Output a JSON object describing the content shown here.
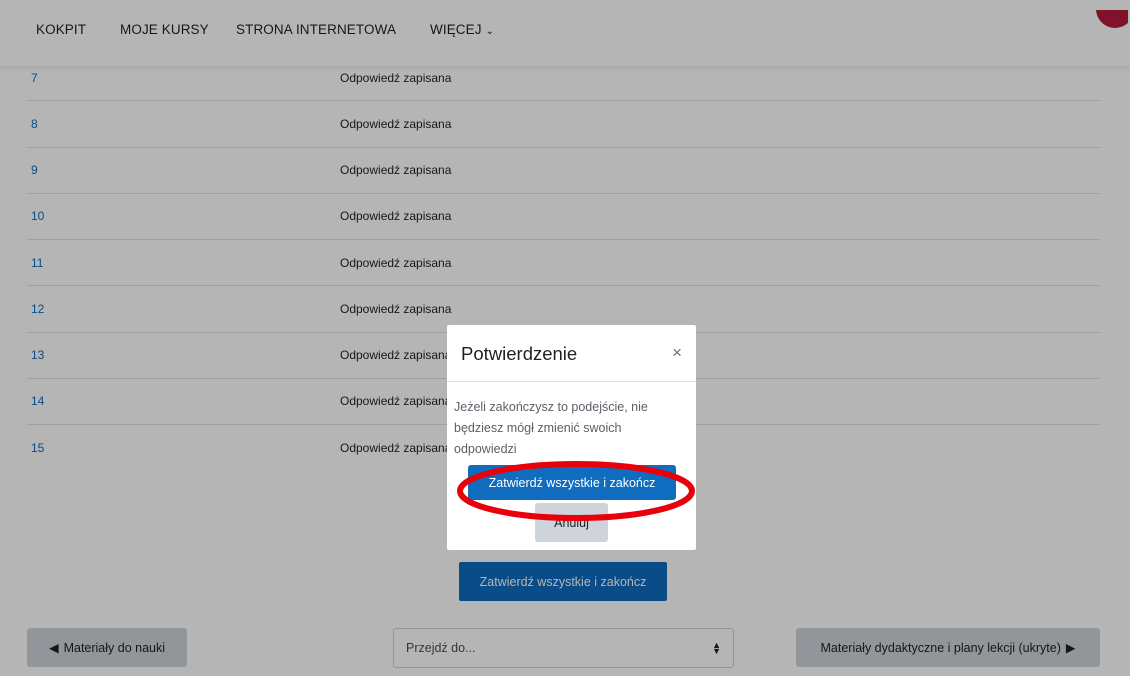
{
  "navbar": {
    "items": [
      {
        "label": "KOKPIT"
      },
      {
        "label": "MOJE KURSY"
      },
      {
        "label": "STRONA INTERNETOWA"
      },
      {
        "label": "WIĘCEJ"
      }
    ],
    "more_chevron": "⌄"
  },
  "summary": {
    "rows": [
      {
        "number": "7",
        "status": "Odpowiedź zapisana"
      },
      {
        "number": "8",
        "status": "Odpowiedź zapisana"
      },
      {
        "number": "9",
        "status": "Odpowiedź zapisana"
      },
      {
        "number": "10",
        "status": "Odpowiedź zapisana"
      },
      {
        "number": "11",
        "status": "Odpowiedź zapisana"
      },
      {
        "number": "12",
        "status": "Odpowiedź zapisana"
      },
      {
        "number": "13",
        "status": "Odpowiedź zapisana"
      },
      {
        "number": "14",
        "status": "Odpowiedź zapisana"
      },
      {
        "number": "15",
        "status": "Odpowiedź zapisana"
      }
    ],
    "submit_label": "Zatwierdź wszystkie i zakończ"
  },
  "navigation": {
    "prev_label": "Materiały do nauki",
    "prev_arrow": "◀",
    "jump_placeholder": "Przejdź do...",
    "next_label": "Materiały dydaktyczne i plany lekcji (ukryte)",
    "next_arrow": "▶"
  },
  "modal": {
    "title": "Potwierdzenie",
    "close_symbol": "×",
    "body": "Jeżeli zakończysz to podejście, nie będziesz mógł zmienić swoich odpowiedzi",
    "confirm_label": "Zatwierdź wszystkie i zakończ",
    "cancel_label": "Anuluj"
  },
  "colors": {
    "primary": "#0f6cbf",
    "secondary": "#ced4da",
    "avatar": "#b51a3a",
    "annotation": "#e8000b"
  }
}
